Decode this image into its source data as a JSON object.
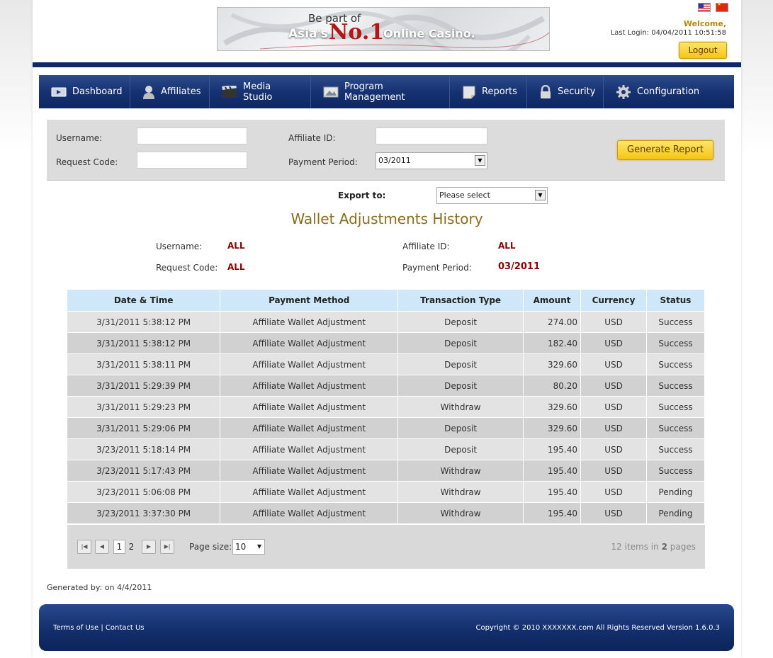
{
  "header": {
    "banner": {
      "line1": "Be part of",
      "asia": "Asia's",
      "no1": "No.1",
      "casino": "Online Casino."
    },
    "welcome": "Welcome,",
    "last_login": "Last Login: 04/04/2011 10:51:58",
    "logout_label": "Logout"
  },
  "nav": {
    "items": [
      {
        "label": "Dashboard",
        "icon": "dashboard-icon"
      },
      {
        "label": "Affiliates",
        "icon": "user-icon"
      },
      {
        "label": "Media Studio",
        "icon": "clapperboard-icon"
      },
      {
        "label": "Program Management",
        "icon": "image-icon"
      },
      {
        "label": "Reports",
        "icon": "notepad-icon"
      },
      {
        "label": "Security",
        "icon": "lock-icon"
      },
      {
        "label": "Configuration",
        "icon": "gear-icon"
      }
    ]
  },
  "filter": {
    "username_label": "Username:",
    "request_code_label": "Request Code:",
    "affiliate_id_label": "Affiliate ID:",
    "payment_period_label": "Payment Period:",
    "payment_period_value": "03/2011",
    "generate_label": "Generate Report"
  },
  "export": {
    "label": "Export to:",
    "value": "Please select"
  },
  "report": {
    "title": "Wallet Adjustments History",
    "username_label": "Username:",
    "username_value": "ALL",
    "request_code_label": "Request Code:",
    "request_code_value": "ALL",
    "affiliate_id_label": "Affiliate ID:",
    "affiliate_id_value": "ALL",
    "payment_period_label": "Payment Period:",
    "payment_period_value": "03/2011"
  },
  "table": {
    "columns": [
      "Date & Time",
      "Payment Method",
      "Transaction Type",
      "Amount",
      "Currency",
      "Status"
    ],
    "rows": [
      [
        "3/31/2011 5:38:12 PM",
        "Affiliate Wallet Adjustment",
        "Deposit",
        "274.00",
        "USD",
        "Success"
      ],
      [
        "3/31/2011 5:38:12 PM",
        "Affiliate Wallet Adjustment",
        "Deposit",
        "182.40",
        "USD",
        "Success"
      ],
      [
        "3/31/2011 5:38:11 PM",
        "Affiliate Wallet Adjustment",
        "Deposit",
        "329.60",
        "USD",
        "Success"
      ],
      [
        "3/31/2011 5:29:39 PM",
        "Affiliate Wallet Adjustment",
        "Deposit",
        "80.20",
        "USD",
        "Success"
      ],
      [
        "3/31/2011 5:29:23 PM",
        "Affiliate Wallet Adjustment",
        "Withdraw",
        "329.60",
        "USD",
        "Success"
      ],
      [
        "3/31/2011 5:29:06 PM",
        "Affiliate Wallet Adjustment",
        "Deposit",
        "329.60",
        "USD",
        "Success"
      ],
      [
        "3/23/2011 5:18:14 PM",
        "Affiliate Wallet Adjustment",
        "Deposit",
        "195.40",
        "USD",
        "Success"
      ],
      [
        "3/23/2011 5:17:43 PM",
        "Affiliate Wallet Adjustment",
        "Withdraw",
        "195.40",
        "USD",
        "Success"
      ],
      [
        "3/23/2011 5:06:08 PM",
        "Affiliate Wallet Adjustment",
        "Withdraw",
        "195.40",
        "USD",
        "Pending"
      ],
      [
        "3/23/2011 3:37:30 PM",
        "Affiliate Wallet Adjustment",
        "Withdraw",
        "195.40",
        "USD",
        "Pending"
      ]
    ]
  },
  "pager": {
    "pages": [
      "1",
      "2"
    ],
    "current_page": "1",
    "page_size_label": "Page size:",
    "page_size_value": "10",
    "items_count": "12",
    "items_text": "items in",
    "pages_count": "2",
    "pages_text": "pages"
  },
  "generated": "Generated by: on 4/4/2011",
  "footer": {
    "terms": "Terms of Use",
    "separator": "|",
    "contact": "Contact Us",
    "copyright": "Copyright © 2010 XXXXXXX.com All Rights Reserved  Version 1.6.0.3"
  },
  "colors": {
    "nav_bg": "#163272",
    "accent_gold": "#f6c415",
    "title_color": "#8b6d1d",
    "value_red": "#8b0000",
    "table_header": "#cfe8f9"
  }
}
